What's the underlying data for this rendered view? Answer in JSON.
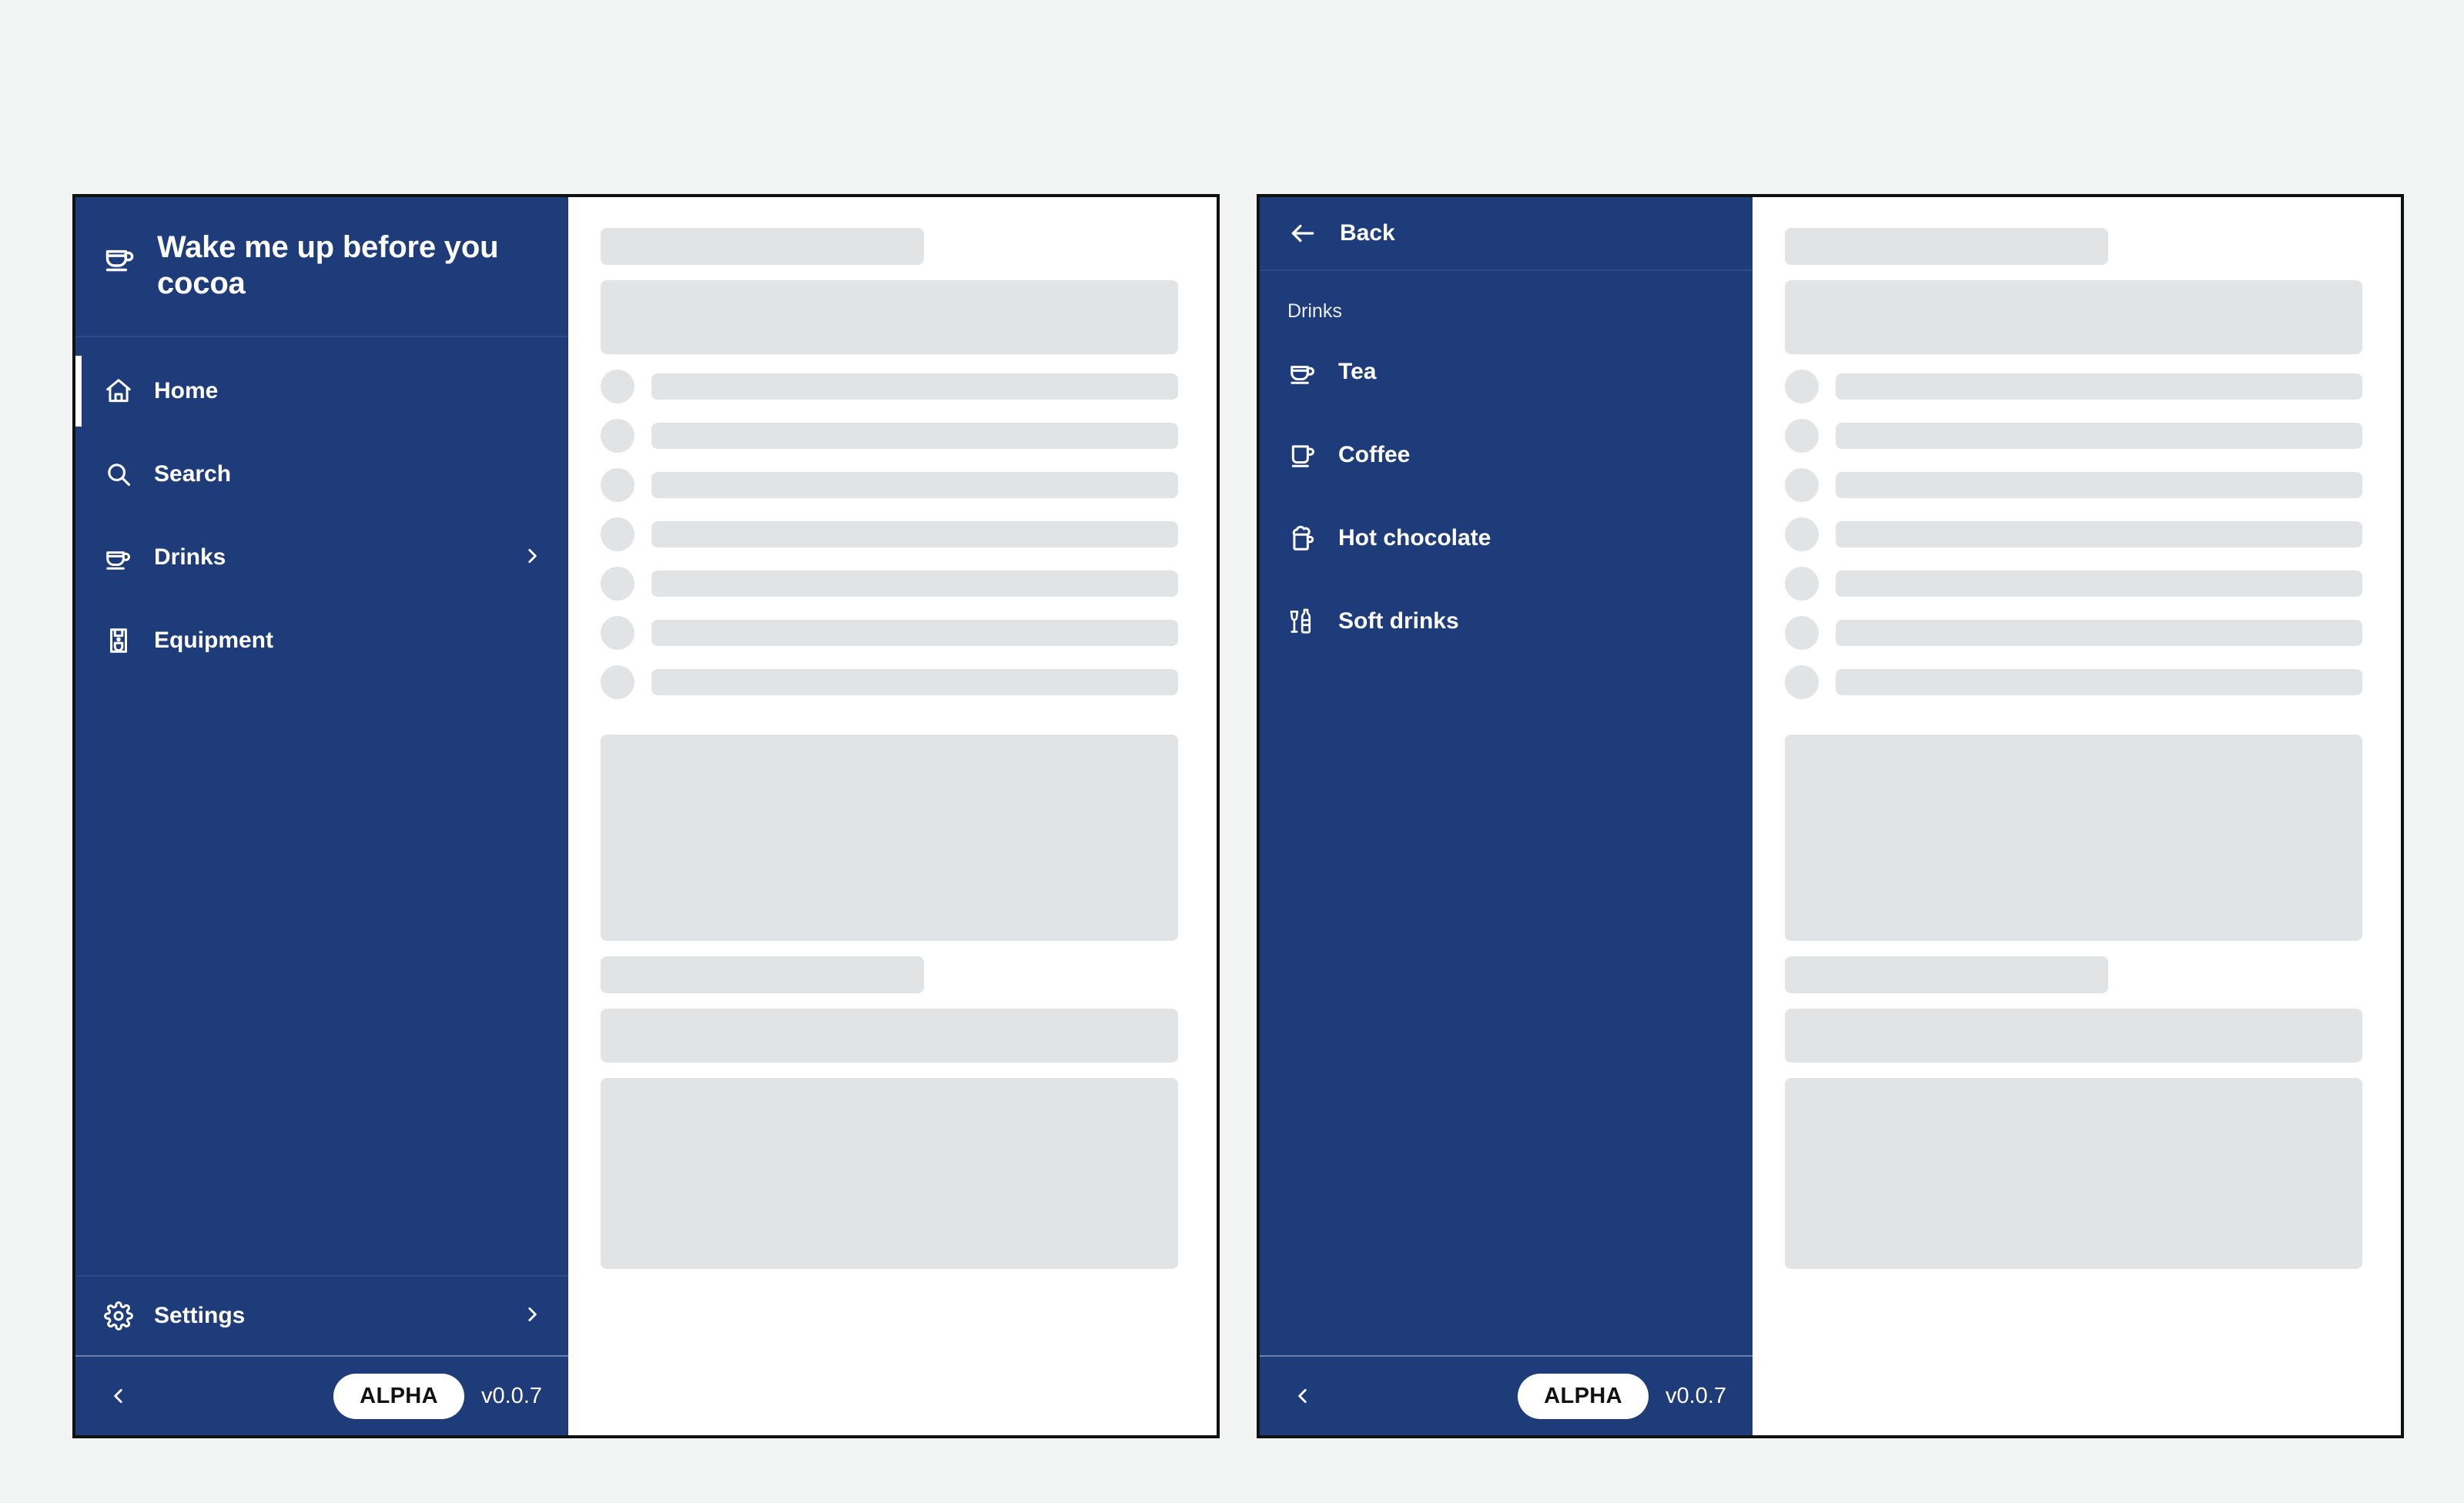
{
  "app": {
    "title": "Wake me up before you cocoa",
    "brand_icon": "coffee-cup-icon"
  },
  "panel_one": {
    "nav": {
      "items": [
        {
          "label": "Home",
          "icon": "home-icon",
          "active": true,
          "chevron": false
        },
        {
          "label": "Search",
          "icon": "search-icon",
          "active": false,
          "chevron": false
        },
        {
          "label": "Drinks",
          "icon": "coffee-cup-icon",
          "active": false,
          "chevron": true
        },
        {
          "label": "Equipment",
          "icon": "coffee-machine-icon",
          "active": false,
          "chevron": false
        }
      ]
    },
    "settings": {
      "label": "Settings",
      "icon": "gear-icon",
      "chevron": true
    },
    "footer": {
      "collapse_icon": "chevron-left-icon",
      "badge": "ALPHA",
      "version": "v0.0.7"
    }
  },
  "panel_two": {
    "header": {
      "back_label": "Back",
      "back_icon": "arrow-left-icon"
    },
    "section_label": "Drinks",
    "nav": {
      "items": [
        {
          "label": "Tea",
          "icon": "tea-cup-icon"
        },
        {
          "label": "Coffee",
          "icon": "coffee-mug-icon"
        },
        {
          "label": "Hot chocolate",
          "icon": "hot-chocolate-icon"
        },
        {
          "label": "Soft drinks",
          "icon": "soft-drinks-icon"
        }
      ]
    },
    "footer": {
      "collapse_icon": "chevron-left-icon",
      "badge": "ALPHA",
      "version": "v0.0.7"
    }
  },
  "colors": {
    "sidebar_blue": "#1e3c7a",
    "page_background": "#f2f3f3",
    "skeleton_gray": "#e2e3e5",
    "panel_border": "#111111",
    "text_on_blue": "#ffffff"
  },
  "content_placeholder": {
    "rows": 7,
    "description": "loading skeleton placeholder blocks"
  }
}
